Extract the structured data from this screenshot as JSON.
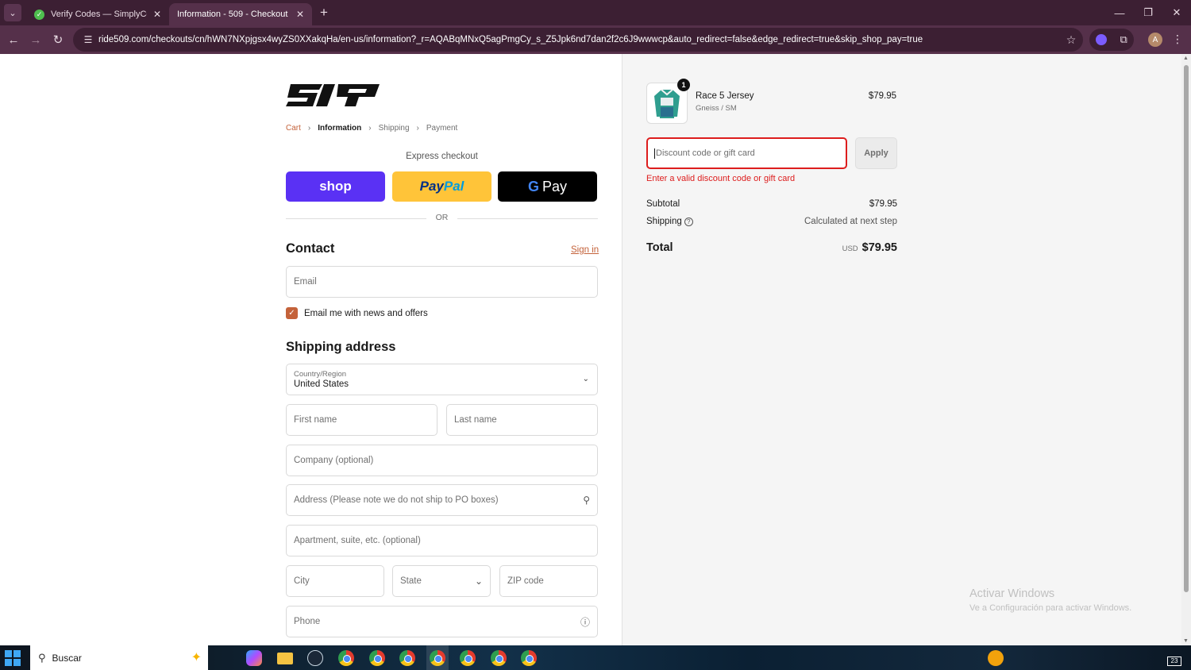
{
  "browser": {
    "tabs": [
      {
        "label": "Verify Codes — SimplyCodes",
        "active": false
      },
      {
        "label": "Information - 509 - Checkout",
        "active": true
      }
    ],
    "url": "ride509.com/checkouts/cn/hWN7NXpjgsx4wyZS0XXakqHa/en-us/information?_r=AQABqMNxQ5agPmgCy_s_Z5Jpk6nd7dan2f2c6J9wwwcp&auto_redirect=false&edge_redirect=true&skip_shop_pay=true",
    "profile_initial": "A"
  },
  "breadcrumb": {
    "cart": "Cart",
    "information": "Information",
    "shipping": "Shipping",
    "payment": "Payment"
  },
  "express": {
    "title": "Express checkout",
    "shop_label": "shop",
    "paypal_a": "Pay",
    "paypal_b": "Pal",
    "gpay_g": "G",
    "gpay_label": "Pay",
    "or_label": "OR"
  },
  "contact": {
    "title": "Contact",
    "signin": "Sign in",
    "email_placeholder": "Email",
    "newsletter_label": "Email me with news and offers",
    "newsletter_checked": true
  },
  "shipping": {
    "title": "Shipping address",
    "country_label": "Country/Region",
    "country_value": "United States",
    "first_name": "First name",
    "last_name": "Last name",
    "company": "Company (optional)",
    "address": "Address (Please note we do not ship to PO boxes)",
    "apartment": "Apartment, suite, etc. (optional)",
    "city": "City",
    "state": "State",
    "zip": "ZIP code",
    "phone": "Phone"
  },
  "summary": {
    "product": {
      "name": "Race 5 Jersey",
      "variant": "Gneiss / SM",
      "price": "$79.95",
      "quantity": "1"
    },
    "discount_placeholder": "Discount code or gift card",
    "apply_label": "Apply",
    "error": "Enter a valid discount code or gift card",
    "subtotal_label": "Subtotal",
    "subtotal_value": "$79.95",
    "shipping_label": "Shipping",
    "shipping_value": "Calculated at next step",
    "total_label": "Total",
    "total_currency": "USD",
    "total_value": "$79.95"
  },
  "windows_watermark": {
    "line1": "Activar Windows",
    "line2": "Ve a Configuración para activar Windows."
  },
  "taskbar": {
    "search_label": "Buscar",
    "tray_count": "23"
  },
  "colors": {
    "accent": "#c4623a",
    "error": "#dd1d1d",
    "shop_pay": "#5a31f4",
    "paypal": "#ffc439"
  }
}
